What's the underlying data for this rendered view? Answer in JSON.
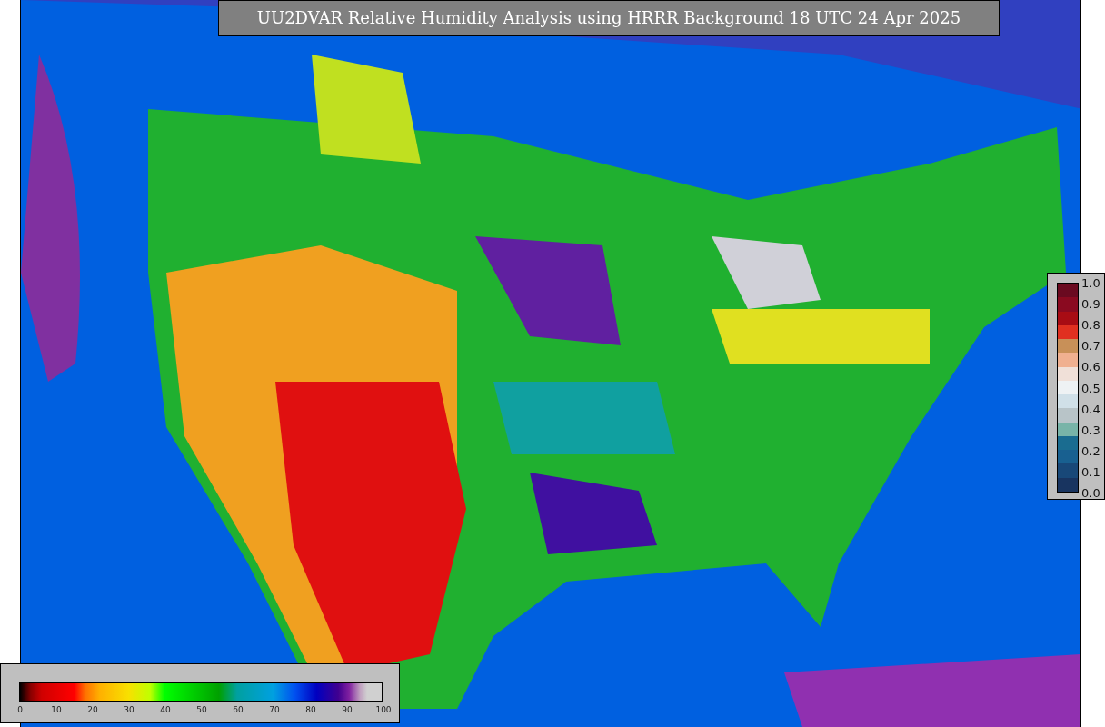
{
  "title": "UU2DVAR Relative Humidity Analysis using HRRR Background 18 UTC 24 Apr 2025",
  "humidity_scale": {
    "ticks": [
      "0",
      "10",
      "20",
      "30",
      "40",
      "50",
      "60",
      "70",
      "80",
      "90",
      "100"
    ]
  },
  "station_scale": {
    "ticks": [
      "1.0",
      "0.9",
      "0.8",
      "0.7",
      "0.6",
      "0.5",
      "0.4",
      "0.3",
      "0.2",
      "0.1",
      "0.0"
    ]
  }
}
